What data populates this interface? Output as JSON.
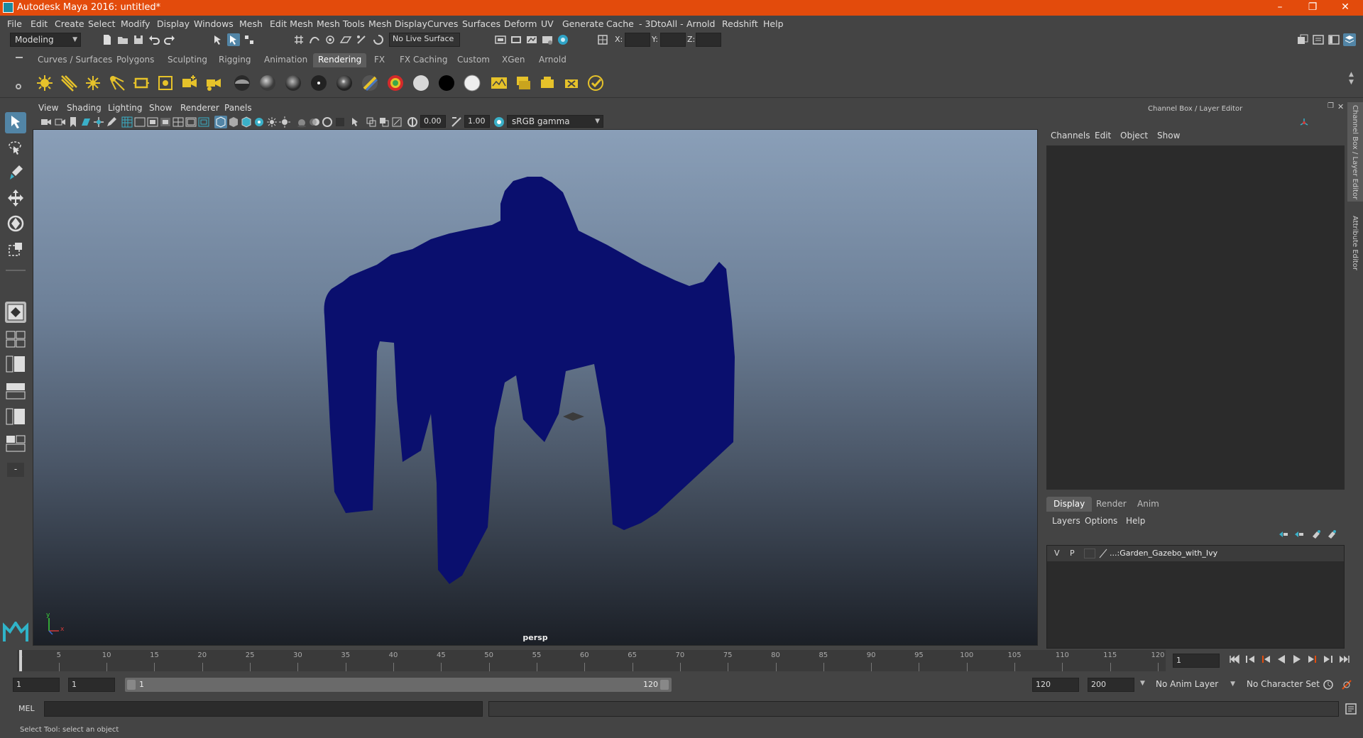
{
  "window": {
    "title": "Autodesk Maya 2016: untitled*",
    "controls": [
      "minimize",
      "maximize",
      "close"
    ]
  },
  "menubar": {
    "items": [
      "File",
      "Edit",
      "Create",
      "Select",
      "Modify",
      "Display",
      "Windows",
      "Mesh",
      "Edit Mesh",
      "Mesh Tools",
      "Mesh Display",
      "Curves",
      "Surfaces",
      "Deform",
      "UV",
      "Generate",
      "Cache",
      "- 3DtoAll -",
      "Arnold",
      "Redshift",
      "Help"
    ]
  },
  "statusline": {
    "mode": "Modeling",
    "live_surface": "No Live Surface",
    "x_label": "X:",
    "y_label": "Y:",
    "z_label": "Z:"
  },
  "shelf": {
    "tabs": [
      "Curves / Surfaces",
      "Polygons",
      "Sculpting",
      "Rigging",
      "Animation",
      "Rendering",
      "FX",
      "FX Caching",
      "Custom",
      "XGen",
      "Arnold"
    ],
    "active_tab": "Rendering"
  },
  "viewport": {
    "menu": [
      "View",
      "Shading",
      "Lighting",
      "Show",
      "Renderer",
      "Panels"
    ],
    "exposure": "0.00",
    "gamma": "1.00",
    "color_space": "sRGB gamma",
    "camera_label": "persp",
    "axis_y": "y",
    "axis_x": "x",
    "object_color": "#0a0f6e"
  },
  "channelbox": {
    "title": "Channel Box / Layer Editor",
    "menu": [
      "Channels",
      "Edit",
      "Object",
      "Show"
    ]
  },
  "layereditor": {
    "tabs": [
      "Display",
      "Render",
      "Anim"
    ],
    "active_tab": "Display",
    "menu": [
      "Layers",
      "Options",
      "Help"
    ],
    "layers": [
      {
        "v": "V",
        "p": "P",
        "name": "...:Garden_Gazebo_with_Ivy"
      }
    ]
  },
  "sidetabs": {
    "channel_box": "Channel Box / Layer Editor",
    "attribute_editor": "Attribute Editor"
  },
  "timeslider": {
    "ticks": [
      "1",
      "5",
      "10",
      "15",
      "20",
      "25",
      "30",
      "35",
      "40",
      "45",
      "50",
      "55",
      "60",
      "65",
      "70",
      "75",
      "80",
      "85",
      "90",
      "95",
      "100",
      "105",
      "110",
      "115",
      "120"
    ],
    "current_frame": "1"
  },
  "rangeslider": {
    "start": "1",
    "playback_start": "1",
    "range_inner_start": "1",
    "range_inner_end": "120",
    "playback_end": "120",
    "end": "200",
    "anim_layer": "No Anim Layer",
    "character_set": "No Character Set"
  },
  "commandline": {
    "label": "MEL"
  },
  "helpline": {
    "text": "Select Tool: select an object"
  }
}
